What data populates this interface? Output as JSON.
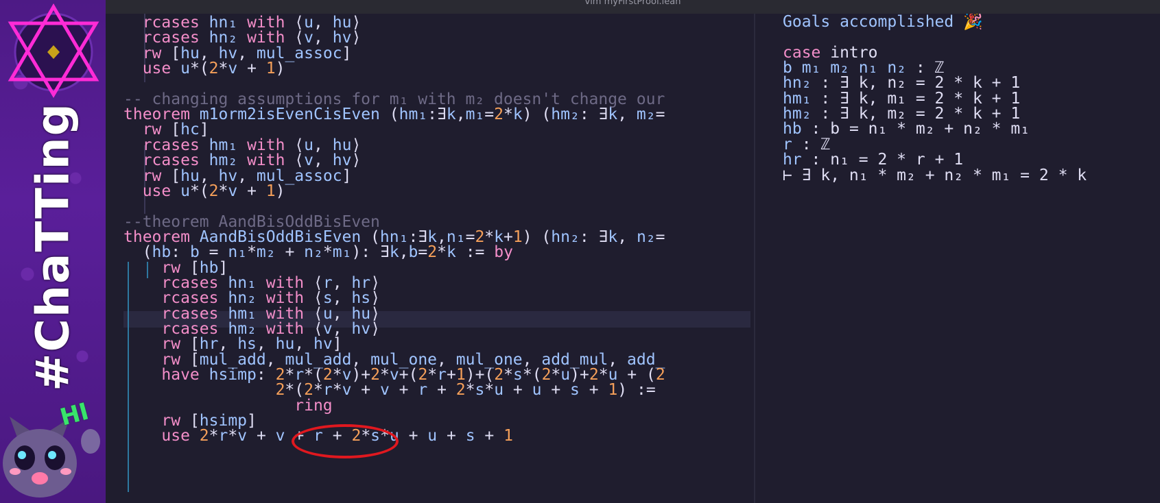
{
  "window": {
    "title": "vim myFirstProof.lean"
  },
  "overlay": {
    "brand": "#ChaTTing",
    "badge": "HI"
  },
  "editor": {
    "lines": [
      [
        "  ",
        {
          "k": "rcases"
        },
        " ",
        {
          "t": "hn₁"
        },
        " ",
        {
          "k": "with"
        },
        " ⟨",
        {
          "t": "u"
        },
        ", ",
        {
          "t": "hu"
        },
        "⟩"
      ],
      [
        "  ",
        {
          "k": "rcases"
        },
        " ",
        {
          "t": "hn₂"
        },
        " ",
        {
          "k": "with"
        },
        " ⟨",
        {
          "t": "v"
        },
        ", ",
        {
          "t": "hv"
        },
        "⟩"
      ],
      [
        "  ",
        {
          "k": "rw"
        },
        " [",
        {
          "t": "hu"
        },
        ", ",
        {
          "t": "hv"
        },
        ", ",
        {
          "t": "mul_assoc"
        },
        "]"
      ],
      [
        "  ",
        {
          "k": "use"
        },
        " ",
        {
          "t": "u"
        },
        "*(",
        {
          "n": "2"
        },
        "*",
        {
          "t": "v"
        },
        " + ",
        {
          "n": "1"
        },
        ")"
      ],
      [
        ""
      ],
      [
        {
          "c": "-- changing assumptions for m₁ with m₂ doesn't change our"
        }
      ],
      [
        {
          "k": "theorem"
        },
        " ",
        {
          "t": "m1orm2isEvenCisEven"
        },
        " (",
        {
          "t": "hm₁"
        },
        ":∃",
        {
          "t": "k"
        },
        ",",
        {
          "t": "m₁"
        },
        "=",
        {
          "n": "2"
        },
        "*",
        {
          "t": "k"
        },
        ") (",
        {
          "t": "hm₂"
        },
        ": ∃",
        {
          "t": "k"
        },
        ", ",
        {
          "t": "m₂"
        },
        "="
      ],
      [
        "  ",
        {
          "k": "rw"
        },
        " [",
        {
          "t": "hc"
        },
        "]"
      ],
      [
        "  ",
        {
          "k": "rcases"
        },
        " ",
        {
          "t": "hm₁"
        },
        " ",
        {
          "k": "with"
        },
        " ⟨",
        {
          "t": "u"
        },
        ", ",
        {
          "t": "hu"
        },
        "⟩"
      ],
      [
        "  ",
        {
          "k": "rcases"
        },
        " ",
        {
          "t": "hm₂"
        },
        " ",
        {
          "k": "with"
        },
        " ⟨",
        {
          "t": "v"
        },
        ", ",
        {
          "t": "hv"
        },
        "⟩"
      ],
      [
        "  ",
        {
          "k": "rw"
        },
        " [",
        {
          "t": "hu"
        },
        ", ",
        {
          "t": "hv"
        },
        ", ",
        {
          "t": "mul_assoc"
        },
        "]"
      ],
      [
        "  ",
        {
          "k": "use"
        },
        " ",
        {
          "t": "u"
        },
        "*(",
        {
          "n": "2"
        },
        "*",
        {
          "t": "v"
        },
        " + ",
        {
          "n": "1"
        },
        ")"
      ],
      [
        ""
      ],
      [
        {
          "c": "--theorem AandBisOddBisEven"
        }
      ],
      [
        {
          "k": "theorem"
        },
        " ",
        {
          "t": "AandBisOddBisEven"
        },
        " (",
        {
          "t": "hn₁"
        },
        ":∃",
        {
          "t": "k"
        },
        ",",
        {
          "t": "n₁"
        },
        "=",
        {
          "n": "2"
        },
        "*",
        {
          "t": "k"
        },
        "+",
        {
          "n": "1"
        },
        ") (",
        {
          "t": "hn₂"
        },
        ": ∃",
        {
          "t": "k"
        },
        ", ",
        {
          "t": "n₂"
        },
        "="
      ],
      [
        "  (",
        {
          "t": "hb"
        },
        ": ",
        {
          "t": "b"
        },
        " = ",
        {
          "t": "n₁"
        },
        "*",
        {
          "t": "m₂"
        },
        " + ",
        {
          "t": "n₂"
        },
        "*",
        {
          "t": "m₁"
        },
        "): ∃",
        {
          "t": "k"
        },
        ",",
        {
          "t": "b"
        },
        "=",
        {
          "n": "2"
        },
        "*",
        {
          "t": "k"
        },
        " := ",
        {
          "k": "by"
        }
      ],
      [
        "    ",
        {
          "k": "rw"
        },
        " [",
        {
          "t": "hb"
        },
        "]"
      ],
      [
        "    ",
        {
          "k": "rcases"
        },
        " ",
        {
          "t": "hn₁"
        },
        " ",
        {
          "k": "with"
        },
        " ⟨",
        {
          "t": "r"
        },
        ", ",
        {
          "t": "hr"
        },
        "⟩"
      ],
      [
        "    ",
        {
          "k": "rcases"
        },
        " ",
        {
          "t": "hn₂"
        },
        " ",
        {
          "k": "with"
        },
        " ⟨",
        {
          "t": "s"
        },
        ", ",
        {
          "t": "hs"
        },
        "⟩"
      ],
      [
        "    ",
        {
          "k": "rcases"
        },
        " ",
        {
          "t": "hm₁"
        },
        " ",
        {
          "k": "with"
        },
        " ⟨",
        {
          "t": "u"
        },
        ", ",
        {
          "t": "hu"
        },
        "⟩"
      ],
      [
        "    ",
        {
          "k": "rcases"
        },
        " ",
        {
          "t": "hm₂"
        },
        " ",
        {
          "k": "with"
        },
        " ⟨",
        {
          "t": "v"
        },
        ", ",
        {
          "t": "hv"
        },
        "⟩"
      ],
      [
        "    ",
        {
          "k": "rw"
        },
        " [",
        {
          "t": "hr"
        },
        ", ",
        {
          "t": "hs"
        },
        ", ",
        {
          "t": "hu"
        },
        ", ",
        {
          "t": "hv"
        },
        "]"
      ],
      [
        "    ",
        {
          "k": "rw"
        },
        " [",
        {
          "t": "mul_add"
        },
        ", ",
        {
          "t": "mul_add"
        },
        ", ",
        {
          "t": "mul_one"
        },
        ", ",
        {
          "t": "mul_one"
        },
        ", ",
        {
          "t": "add_mul"
        },
        ", ",
        {
          "t": "add_"
        }
      ],
      [
        "    ",
        {
          "k": "have"
        },
        " ",
        {
          "t": "hsimp"
        },
        ": ",
        {
          "n": "2"
        },
        "*",
        {
          "t": "r"
        },
        "*(",
        {
          "n": "2"
        },
        "*",
        {
          "t": "v"
        },
        ")+",
        {
          "n": "2"
        },
        "*",
        {
          "t": "v"
        },
        "+(",
        {
          "n": "2"
        },
        "*",
        {
          "t": "r"
        },
        "+",
        {
          "n": "1"
        },
        ")+(",
        {
          "n": "2"
        },
        "*",
        {
          "t": "s"
        },
        "*(",
        {
          "n": "2"
        },
        "*",
        {
          "t": "u"
        },
        ")+",
        {
          "n": "2"
        },
        "*",
        {
          "t": "u"
        },
        " + (",
        {
          "n": "2"
        }
      ],
      [
        "                ",
        {
          "n": "2"
        },
        "*(",
        {
          "n": "2"
        },
        "*",
        {
          "t": "r"
        },
        "*",
        {
          "t": "v"
        },
        " + ",
        {
          "t": "v"
        },
        " + ",
        {
          "t": "r"
        },
        " + ",
        {
          "n": "2"
        },
        "*",
        {
          "t": "s"
        },
        "*",
        {
          "t": "u"
        },
        " + ",
        {
          "t": "u"
        },
        " + ",
        {
          "t": "s"
        },
        " + ",
        {
          "n": "1"
        },
        ") :="
      ],
      [
        "                  ",
        {
          "k": "ring"
        }
      ],
      [
        "    ",
        {
          "k": "rw"
        },
        " [",
        {
          "t": "hsimp"
        },
        "]"
      ],
      [
        "    ",
        {
          "k": "use"
        },
        " ",
        {
          "n": "2"
        },
        "*",
        {
          "t": "r"
        },
        "*",
        {
          "t": "v"
        },
        " + ",
        {
          "t": "v"
        },
        " + ",
        {
          "t": "r"
        },
        " + ",
        {
          "n": "2"
        },
        "*",
        {
          "t": "s"
        },
        "*",
        {
          "t": "u"
        },
        " + ",
        {
          "t": "u"
        },
        " + ",
        {
          "t": "s"
        },
        " + ",
        {
          "n": "1"
        }
      ]
    ]
  },
  "infoview": {
    "lines": [
      [
        {
          "g": "Goals accomplished 🎉"
        }
      ],
      [
        ""
      ],
      [
        {
          "k": "case"
        },
        " intro"
      ],
      [
        {
          "g": "b m₁ m₂ n₁ n₂"
        },
        " : ℤ"
      ],
      [
        {
          "g": "hn₂"
        },
        " : ∃ k, n₂ = 2 * k + 1"
      ],
      [
        {
          "g": "hm₁"
        },
        " : ∃ k, m₁ = 2 * k + 1"
      ],
      [
        {
          "g": "hm₂"
        },
        " : ∃ k, m₂ = 2 * k + 1"
      ],
      [
        {
          "g": "hb"
        },
        " : b = n₁ * m₂ + n₂ * m₁"
      ],
      [
        {
          "g": "r"
        },
        " : ℤ"
      ],
      [
        {
          "g": "hr"
        },
        " : n₁ = 2 * r + 1"
      ],
      [
        "⊢ ∃ k, n₁ * m₂ + n₂ * m₁ = 2 * k"
      ]
    ]
  }
}
